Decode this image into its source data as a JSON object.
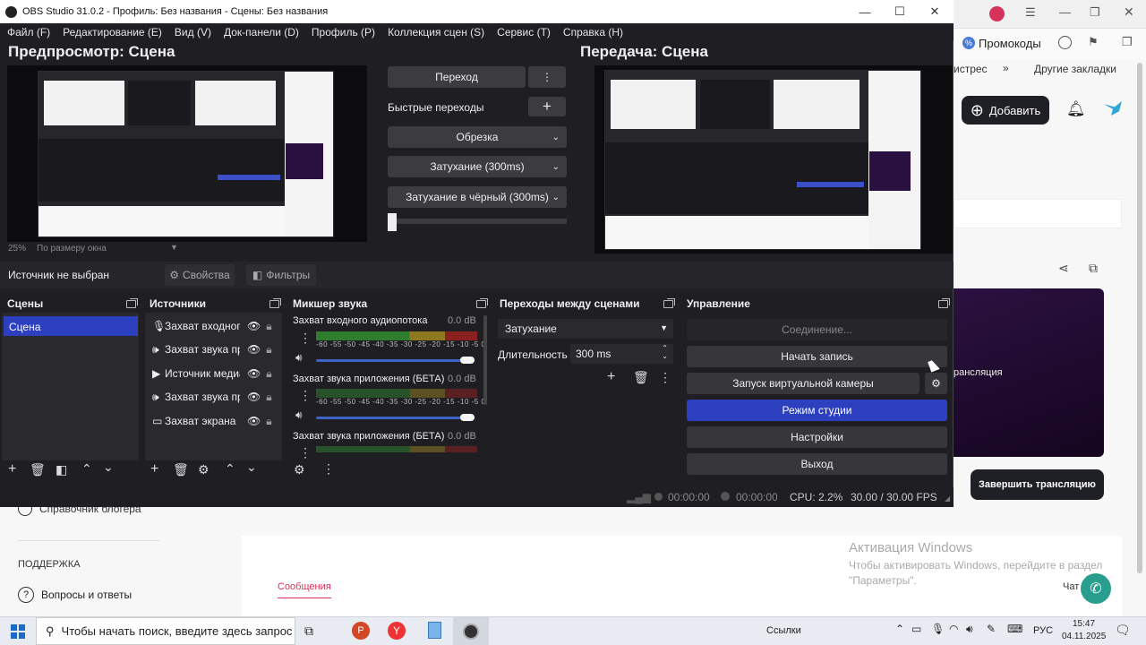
{
  "window": {
    "title": "OBS Studio 31.0.2 - Профиль: Без названия - Сцены: Без названия",
    "minimize": "—",
    "maximize": "☐",
    "close": "✕"
  },
  "menu": [
    "Файл (F)",
    "Редактирование (E)",
    "Вид (V)",
    "Док-панели (D)",
    "Профиль (P)",
    "Коллекция сцен (S)",
    "Сервис (T)",
    "Справка (H)"
  ],
  "preview": {
    "title": "Предпросмотр: Сцена",
    "zoom": "25%",
    "zoom_mode": "По размеру окна"
  },
  "program": {
    "title": "Передача: Сцена"
  },
  "transition_panel": {
    "transition_button": "Переход",
    "quick_transitions": "Быстрые переходы",
    "quick": [
      "Обрезка",
      "Затухание (300ms)",
      "Затухание в чёрный (300ms)"
    ]
  },
  "source_toolbar": {
    "no_source": "Источник не выбран",
    "properties": "Свойства",
    "filters": "Фильтры"
  },
  "docks": {
    "scenes": {
      "title": "Сцены",
      "items": [
        "Сцена"
      ]
    },
    "sources": {
      "title": "Источники",
      "items": [
        "Захват входного",
        "Захват звука пр",
        "Источник медиа",
        "Захват звука пр",
        "Захват экрана"
      ]
    },
    "mixer": {
      "title": "Микшер звука",
      "channels": [
        {
          "name": "Захват входного аудиопотока",
          "db": "0.0 dB",
          "level": 0.85,
          "volume": 1.0
        },
        {
          "name": "Захват звука приложения (БЕТА)",
          "db": "0.0 dB",
          "level": 0.0,
          "volume": 1.0
        },
        {
          "name": "Захват звука приложения (БЕТА)",
          "db": "0.0 dB",
          "level": 0.0,
          "volume": 1.0
        }
      ],
      "scale": "-60 -55 -50 -45 -40 -35 -30 -25 -20 -15 -10  -5   0"
    },
    "transitions": {
      "title": "Переходы между сценами",
      "selected": "Затухание",
      "duration_label": "Длительность",
      "duration_value": "300 ms"
    },
    "controls": {
      "title": "Управление",
      "connection": "Соединение...",
      "start_recording": "Начать запись",
      "virtual_camera": "Запуск виртуальной камеры",
      "studio_mode": "Режим студии",
      "settings": "Настройки",
      "exit": "Выход"
    }
  },
  "status": {
    "stream_time": "00:00:00",
    "record_time": "00:00:00",
    "cpu": "CPU: 2.2%",
    "fps": "30.00 / 30.00 FPS"
  },
  "browser": {
    "promo": "Промокоды",
    "tab_partial": "истрес",
    "bookmarks_more": "»",
    "other_bookmarks": "Другие закладки",
    "add_button": "Добавить",
    "stream_label": "рансляция",
    "end_stream": "Завершить трансляцию",
    "sidebar_guide": "Справочник блогера",
    "support_heading": "ПОДДЕРЖКА",
    "faq": "Вопросы и ответы",
    "messages_tab": "Сообщения",
    "chat_partial": "Чат",
    "activation_title": "Активация Windows",
    "activation_text_1": "Чтобы активировать Windows, перейдите в раздел",
    "activation_text_2": "\"Параметры\"."
  },
  "taskbar": {
    "search_placeholder": "Чтобы начать поиск, введите здесь запрос",
    "links": "Ссылки",
    "lang": "РУС",
    "time": "15:47",
    "date": "04.11.2025"
  },
  "colors": {
    "obs_bg": "#1f1f23",
    "accent_blue": "#2b3fbf",
    "panel": "#2a2a2e"
  }
}
